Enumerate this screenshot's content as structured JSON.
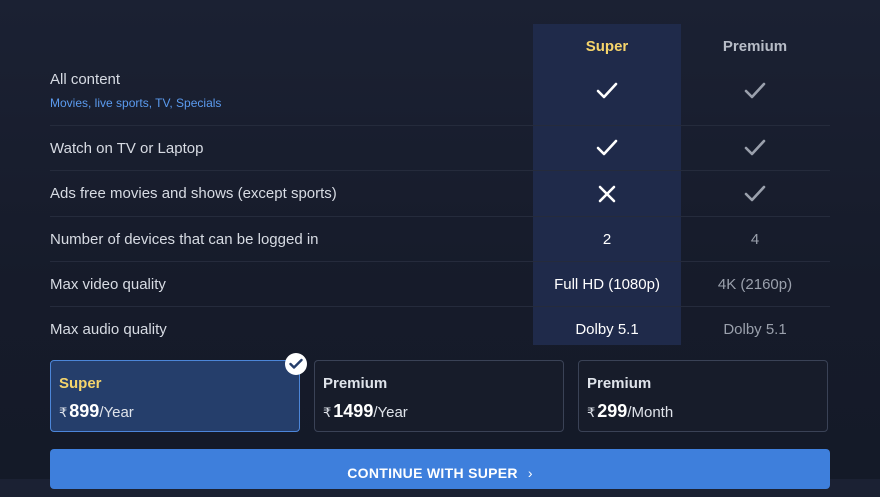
{
  "columns": {
    "super": "Super",
    "premium": "Premium"
  },
  "rows": [
    {
      "label": "All content",
      "sub": "Movies, live sports, TV, Specials",
      "super": "check",
      "premium": "check"
    },
    {
      "label": "Watch on TV or Laptop",
      "super": "check",
      "premium": "check"
    },
    {
      "label": "Ads free movies and shows (except sports)",
      "super": "cross",
      "premium": "check"
    },
    {
      "label": "Number of devices that can be logged in",
      "super": "2",
      "premium": "4"
    },
    {
      "label": "Max video quality",
      "super": "Full HD (1080p)",
      "premium": "4K (2160p)"
    },
    {
      "label": "Max audio quality",
      "super": "Dolby 5.1",
      "premium": "Dolby 5.1"
    }
  ],
  "plans": [
    {
      "name": "Super",
      "currency": "₹",
      "amount": "899",
      "period": "/Year",
      "selected": true
    },
    {
      "name": "Premium",
      "currency": "₹",
      "amount": "1499",
      "period": "/Year",
      "selected": false
    },
    {
      "name": "Premium",
      "currency": "₹",
      "amount": "299",
      "period": "/Month",
      "selected": false
    }
  ],
  "cta": {
    "label": "CONTINUE WITH SUPER"
  },
  "colors": {
    "accent": "#3e7fdc",
    "super_gold": "#f5d46b",
    "link_blue": "#5b9bef"
  }
}
